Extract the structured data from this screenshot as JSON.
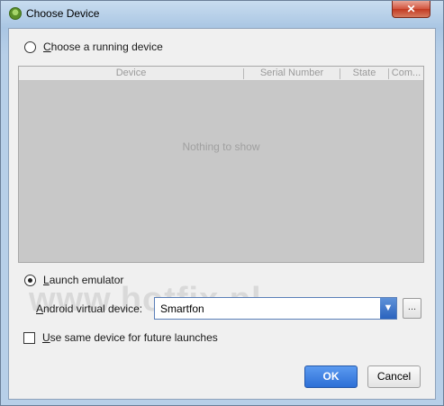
{
  "window": {
    "title": "Choose Device",
    "close_glyph": "✕",
    "app_icon": "android-studio-icon"
  },
  "running": {
    "label_first": "C",
    "label_rest": "hoose a running device",
    "selected": false,
    "columns": [
      "Device",
      "Serial Number",
      "State",
      "Com..."
    ],
    "empty_text": "Nothing to show"
  },
  "emulator": {
    "label_first": "L",
    "label_rest": "aunch emulator",
    "selected": true,
    "avd_label_first": "A",
    "avd_label_rest": "ndroid virtual device:",
    "avd_value": "Smartfon",
    "arrow_glyph": "▼",
    "more_label": "..."
  },
  "same_device": {
    "label_first": "U",
    "label_rest": "se same device for future launches",
    "checked": false
  },
  "buttons": {
    "ok": "OK",
    "cancel": "Cancel"
  },
  "watermark": "www.hotfix.pl",
  "colors": {
    "ok_button": "#2d6fd6",
    "table_bg": "#c8c8c8",
    "title_bar": "#b9d1ea"
  }
}
